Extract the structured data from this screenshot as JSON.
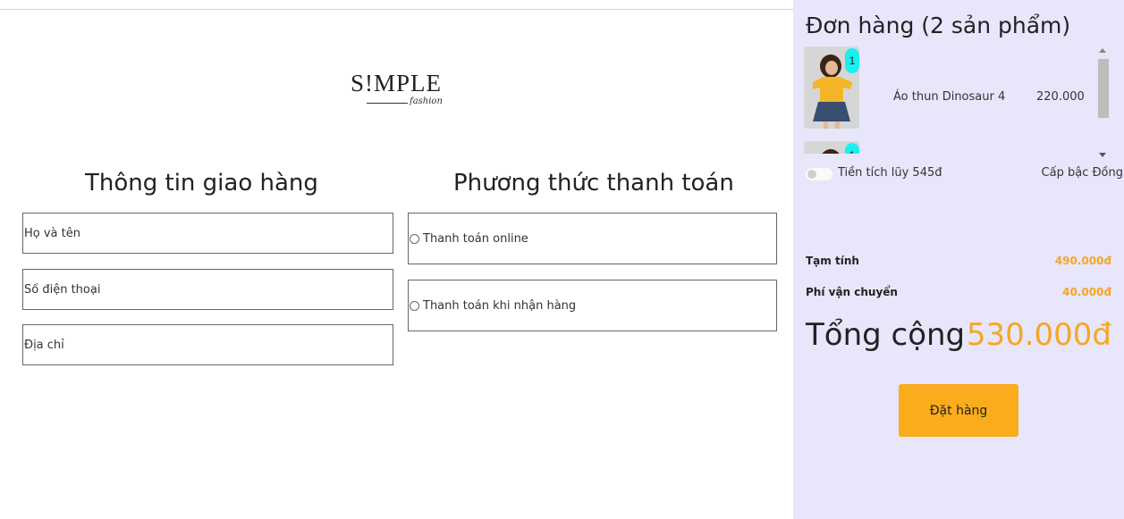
{
  "brand": {
    "name": "S!MPLE",
    "tagline": "fashion"
  },
  "shipping": {
    "title": "Thông tin giao hàng",
    "fields": [
      {
        "placeholder": "Họ và tên"
      },
      {
        "placeholder": "Số điện thoại"
      },
      {
        "placeholder": "Địa chỉ"
      }
    ]
  },
  "payment": {
    "title": "Phương thức thanh toán",
    "options": [
      {
        "label": "Thanh toán online"
      },
      {
        "label": "Thanh toán khi nhận hàng"
      }
    ]
  },
  "order": {
    "title": "Đơn hàng (2 sản phẩm)",
    "items": [
      {
        "quantity": "1",
        "name": "Áo thun Dinosaur 4",
        "price": "220.000"
      },
      {
        "quantity": "1"
      }
    ],
    "loyalty_label": "Tiền tích lũy 545đ",
    "tier_label": "Cấp bậc Đồng",
    "subtotal_label": "Tạm tính",
    "subtotal_value": "490.000đ",
    "shipping_label": "Phí vận chuyển",
    "shipping_value": "40.000đ",
    "total_label": "Tổng cộng",
    "total_value": "530.000đ",
    "place_order_label": "Đặt hàng"
  },
  "colors": {
    "panel_bg": "#e7e6fb",
    "accent_orange": "#fbac1c",
    "price_orange": "#f5a623",
    "qty_badge": "#19f0f0"
  }
}
